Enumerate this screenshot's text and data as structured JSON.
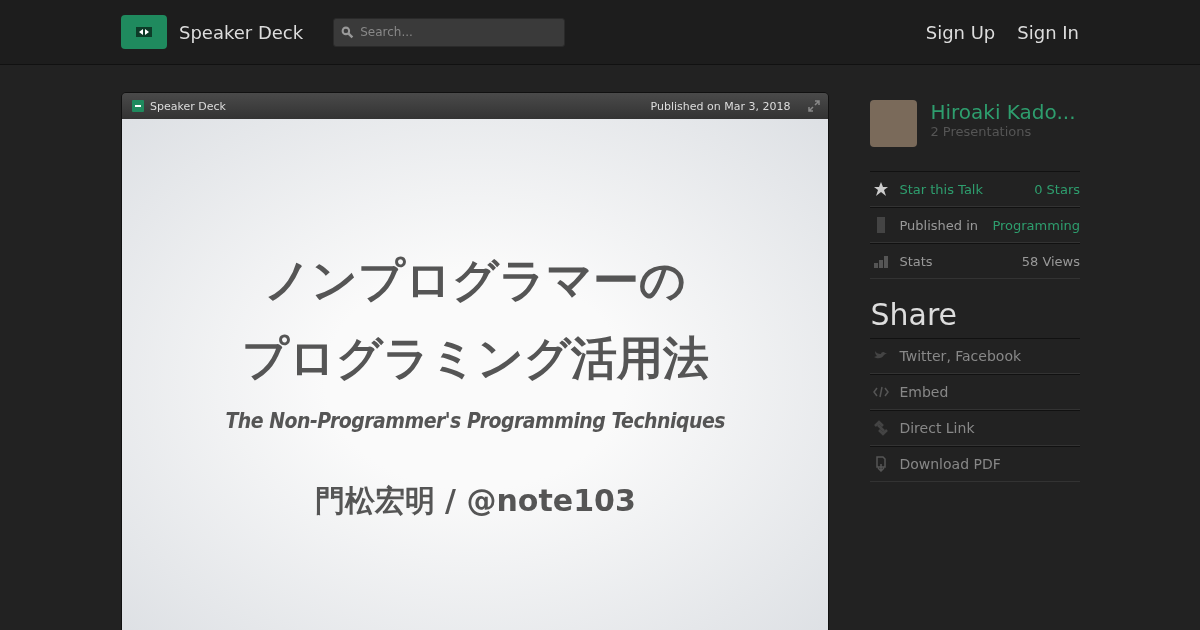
{
  "header": {
    "brand": "Speaker Deck",
    "search": {
      "placeholder": "Search..."
    },
    "links": [
      "Sign Up",
      "Sign In"
    ]
  },
  "player": {
    "brand": "Speaker Deck",
    "published": "Published on Mar 3, 2018",
    "slide": {
      "title_lines": [
        "ノンプログラマーの",
        "プログラミング活用法"
      ],
      "subtitle": "The Non-Programmer's Programming Techniques",
      "author": "門松宏明 / @note103"
    }
  },
  "sidebar": {
    "author": {
      "name": "Hiroaki Kado...",
      "presentations": "2 Presentations"
    },
    "details": [
      {
        "kind": "star",
        "label": "Star this Talk",
        "value": "0 Stars"
      },
      {
        "kind": "category",
        "label": "Published in",
        "value": "Programming"
      },
      {
        "kind": "stats",
        "label": "Stats",
        "value": "58 Views"
      }
    ],
    "share_title": "Share",
    "share": [
      {
        "kind": "social",
        "label": "Twitter, Facebook"
      },
      {
        "kind": "embed",
        "label": "Embed"
      },
      {
        "kind": "link",
        "label": "Direct Link"
      },
      {
        "kind": "pdf",
        "label": "Download PDF"
      }
    ]
  }
}
